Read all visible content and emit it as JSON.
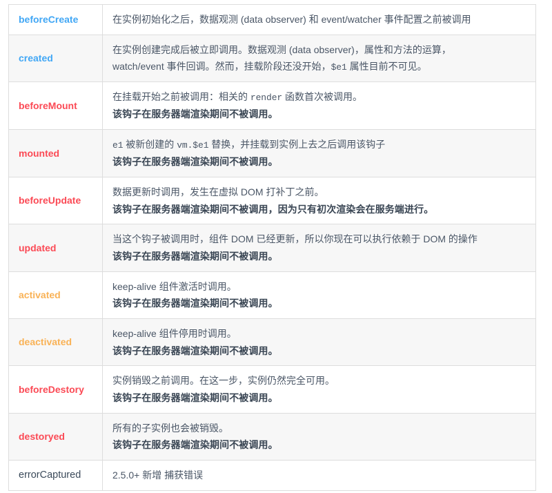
{
  "table": {
    "accent_colors": {
      "blue": "#41a7f5",
      "red": "#fb4a55",
      "orange": "#f9b256",
      "plain": "#3b4a5a",
      "border": "#dddddd",
      "stripe": "#f7f7f7"
    },
    "rows": [
      {
        "hook": "beforeCreate",
        "color": "blue",
        "bold": true,
        "striped": false,
        "lines": [
          {
            "bold": false,
            "parts": [
              {
                "t": "text",
                "v": "在实例初始化之后，数据观测 (data observer) 和 event/watcher 事件配置之前被调用"
              }
            ]
          }
        ]
      },
      {
        "hook": "created",
        "color": "blue",
        "bold": true,
        "striped": true,
        "lines": [
          {
            "bold": false,
            "parts": [
              {
                "t": "text",
                "v": "在实例创建完成后被立即调用。数据观测 (data observer)，属性和方法的运算，"
              }
            ]
          },
          {
            "bold": false,
            "parts": [
              {
                "t": "text",
                "v": "watch/event 事件回调。然而，挂载阶段还没开始，"
              },
              {
                "t": "code",
                "v": "$e1"
              },
              {
                "t": "text",
                "v": " 属性目前不可见。"
              }
            ]
          }
        ]
      },
      {
        "hook": "beforeMount",
        "color": "red",
        "bold": true,
        "striped": false,
        "lines": [
          {
            "bold": false,
            "parts": [
              {
                "t": "text",
                "v": "在挂载开始之前被调用：相关的 "
              },
              {
                "t": "code",
                "v": "render"
              },
              {
                "t": "text",
                "v": " 函数首次被调用。"
              }
            ]
          },
          {
            "bold": true,
            "parts": [
              {
                "t": "text",
                "v": "该钩子在服务器端渲染期间不被调用。"
              }
            ]
          }
        ]
      },
      {
        "hook": "mounted",
        "color": "red",
        "bold": true,
        "striped": true,
        "lines": [
          {
            "bold": false,
            "parts": [
              {
                "t": "code",
                "v": "e1"
              },
              {
                "t": "text",
                "v": " 被新创建的 "
              },
              {
                "t": "code",
                "v": "vm.$e1"
              },
              {
                "t": "text",
                "v": " 替换，并挂载到实例上去之后调用该钩子"
              }
            ]
          },
          {
            "bold": true,
            "parts": [
              {
                "t": "text",
                "v": "该钩子在服务器端渲染期间不被调用。"
              }
            ]
          }
        ]
      },
      {
        "hook": "beforeUpdate",
        "color": "red",
        "bold": true,
        "striped": false,
        "lines": [
          {
            "bold": false,
            "parts": [
              {
                "t": "text",
                "v": "数据更新时调用，发生在虚拟 DOM 打补丁之前。"
              }
            ]
          },
          {
            "bold": true,
            "parts": [
              {
                "t": "text",
                "v": "该钩子在服务器端渲染期间不被调用，因为只有初次渲染会在服务端进行。"
              }
            ]
          }
        ]
      },
      {
        "hook": "updated",
        "color": "red",
        "bold": true,
        "striped": true,
        "lines": [
          {
            "bold": false,
            "parts": [
              {
                "t": "text",
                "v": "当这个钩子被调用时，组件 DOM 已经更新，所以你现在可以执行依赖于 DOM 的操作"
              }
            ]
          },
          {
            "bold": true,
            "parts": [
              {
                "t": "text",
                "v": "该钩子在服务器端渲染期间不被调用。"
              }
            ]
          }
        ]
      },
      {
        "hook": "activated",
        "color": "orange",
        "bold": true,
        "striped": false,
        "lines": [
          {
            "bold": false,
            "parts": [
              {
                "t": "text",
                "v": "keep-alive 组件激活时调用。"
              }
            ]
          },
          {
            "bold": true,
            "parts": [
              {
                "t": "text",
                "v": "该钩子在服务器端渲染期间不被调用。"
              }
            ]
          }
        ]
      },
      {
        "hook": "deactivated",
        "color": "orange",
        "bold": true,
        "striped": true,
        "lines": [
          {
            "bold": false,
            "parts": [
              {
                "t": "text",
                "v": "keep-alive 组件停用时调用。"
              }
            ]
          },
          {
            "bold": true,
            "parts": [
              {
                "t": "text",
                "v": "该钩子在服务器端渲染期间不被调用。"
              }
            ]
          }
        ]
      },
      {
        "hook": "beforeDestory",
        "color": "red",
        "bold": true,
        "striped": false,
        "lines": [
          {
            "bold": false,
            "parts": [
              {
                "t": "text",
                "v": "实例销毁之前调用。在这一步，实例仍然完全可用。"
              }
            ]
          },
          {
            "bold": true,
            "parts": [
              {
                "t": "text",
                "v": "该钩子在服务器端渲染期间不被调用。"
              }
            ]
          }
        ]
      },
      {
        "hook": "destoryed",
        "color": "red",
        "bold": true,
        "striped": true,
        "lines": [
          {
            "bold": false,
            "parts": [
              {
                "t": "text",
                "v": "所有的子实例也会被销毁。"
              }
            ]
          },
          {
            "bold": true,
            "parts": [
              {
                "t": "text",
                "v": "该钩子在服务器端渲染期间不被调用。"
              }
            ]
          }
        ]
      },
      {
        "hook": "errorCaptured",
        "color": "plain",
        "bold": false,
        "striped": false,
        "lines": [
          {
            "bold": false,
            "parts": [
              {
                "t": "text",
                "v": "2.5.0+ 新增  捕获错误"
              }
            ]
          }
        ]
      }
    ]
  }
}
